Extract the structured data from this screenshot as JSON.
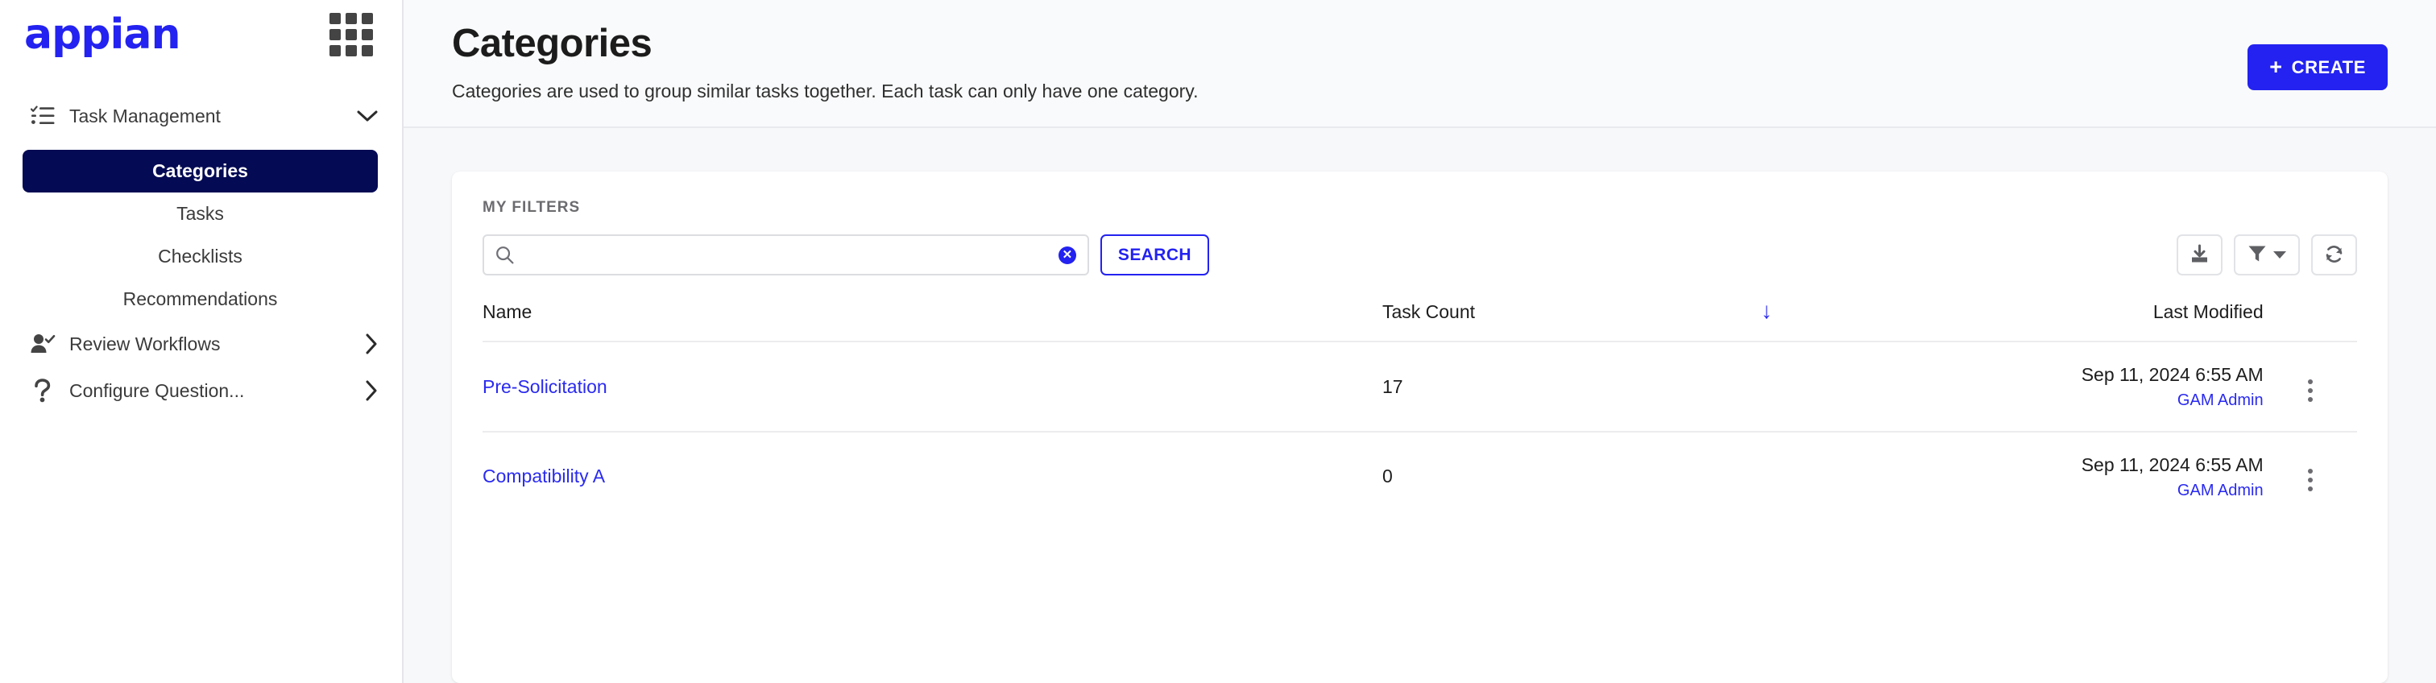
{
  "sidebar": {
    "logo_text": "appian",
    "app_switcher_icon": "grid-apps-icon",
    "groups": [
      {
        "label": "Task Management",
        "icon": "checklist-icon",
        "caret": "chevron-down-icon",
        "expanded": true,
        "children": [
          {
            "label": "Categories",
            "active": true
          },
          {
            "label": "Tasks",
            "active": false
          },
          {
            "label": "Checklists",
            "active": false
          },
          {
            "label": "Recommendations",
            "active": false
          }
        ]
      },
      {
        "label": "Review Workflows",
        "icon": "user-check-icon",
        "caret": "chevron-right-icon",
        "expanded": false,
        "children": []
      },
      {
        "label": "Configure Question...",
        "icon": "question-mark-icon",
        "caret": "chevron-right-icon",
        "expanded": false,
        "children": []
      }
    ]
  },
  "header": {
    "title": "Categories",
    "subtitle": "Categories are used to group similar tasks together. Each task can only have one category.",
    "create_label": "CREATE",
    "create_plus": "+",
    "create_color": "#2322f0"
  },
  "filters": {
    "label": "MY FILTERS",
    "search_value": "",
    "search_placeholder": "",
    "search_icon": "magnifier-icon",
    "clear_icon": "✕",
    "search_button": "SEARCH",
    "tools": [
      {
        "name": "export-button",
        "icon": "download-export-icon"
      },
      {
        "name": "filter-button",
        "icon": "funnel-icon"
      },
      {
        "name": "refresh-button",
        "icon": "refresh-icon"
      }
    ]
  },
  "table": {
    "columns": [
      "Name",
      "Task Count",
      "",
      "Last Modified"
    ],
    "sort_indicator": "↓",
    "sort_column": "Task Count",
    "sort_direction": "descending",
    "rows": [
      {
        "name": "Pre-Solicitation",
        "task_count": "17",
        "modified_date": "Sep 11, 2024 6:55 AM",
        "modified_by": "GAM Admin"
      },
      {
        "name": "Compatibility A",
        "task_count": "0",
        "modified_date": "Sep 11, 2024 6:55 AM",
        "modified_by": "GAM Admin"
      }
    ]
  },
  "colors": {
    "brand_blue": "#2322f0",
    "nav_active": "#040a53",
    "link": "#2a2af0",
    "page_bg": "#f7f8fa"
  }
}
